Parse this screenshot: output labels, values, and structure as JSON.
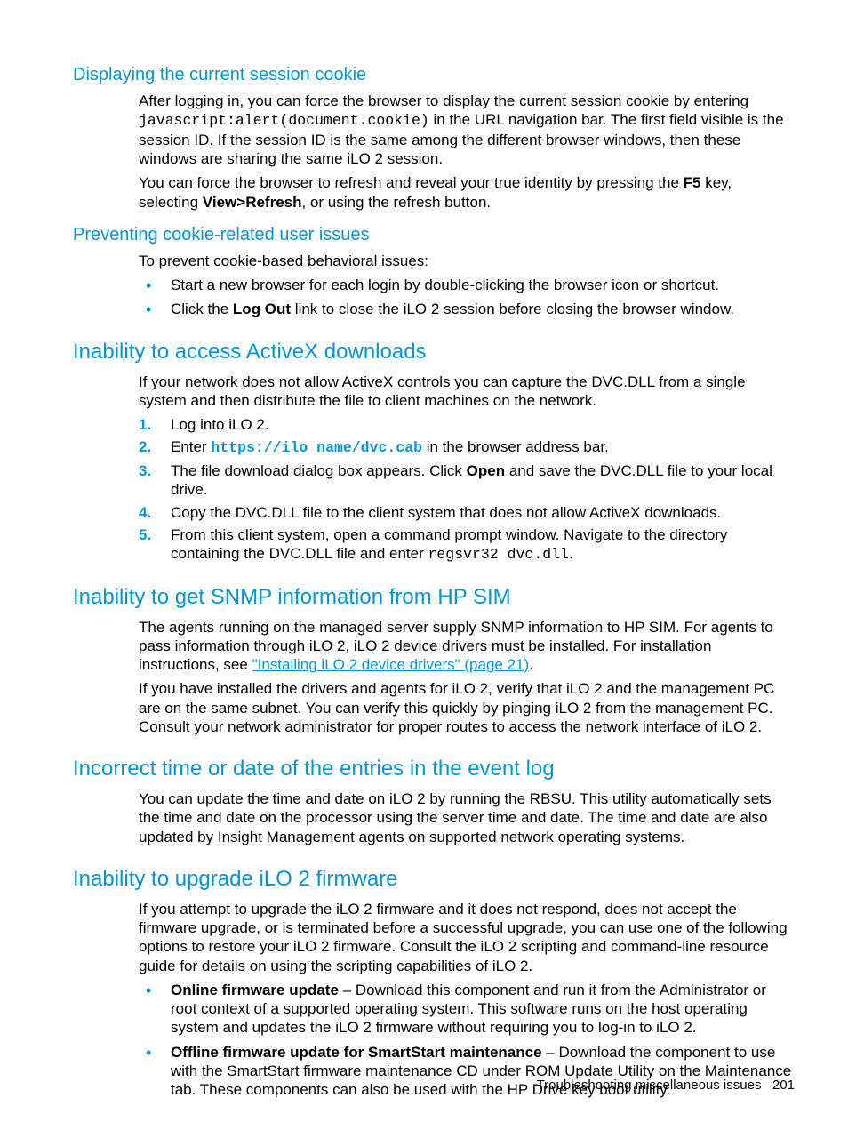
{
  "h_cookie_display": "Displaying the current session cookie",
  "p_cookie1a": "After logging in, you can force the browser to display the current session cookie by entering ",
  "p_cookie1_code": "javascript:alert(document.cookie)",
  "p_cookie1b": " in the URL navigation bar. The first field visible is the session ID. If the session ID is the same among the different browser windows, then these windows are sharing the same iLO 2 session.",
  "p_cookie2a": "You can force the browser to refresh and reveal your true identity by pressing the ",
  "p_cookie2_f5": "F5",
  "p_cookie2b": " key, selecting ",
  "p_cookie2_view": "View>Refresh",
  "p_cookie2c": ", or using the refresh button.",
  "h_prevent": "Preventing cookie-related user issues",
  "p_prevent_intro": "To prevent cookie-based behavioral issues:",
  "li_prevent1": "Start a new browser for each login by double-clicking the browser icon or shortcut.",
  "li_prevent2a": "Click the ",
  "li_prevent2b": "Log Out",
  "li_prevent2c": " link to close the iLO 2 session before closing the browser window.",
  "h_activex": "Inability to access ActiveX downloads",
  "p_activex_intro": "If your network does not allow ActiveX controls you can capture the DVC.DLL from a single system and then distribute the file to client machines on the network.",
  "li_ax1": "Log into iLO 2.",
  "li_ax2a": "Enter ",
  "li_ax2_link": "https://ilo_name/dvc.cab",
  "li_ax2b": " in the browser address bar.",
  "li_ax3a": "The file download dialog box appears. Click ",
  "li_ax3_open": "Open",
  "li_ax3b": " and save the DVC.DLL file to your local drive.",
  "li_ax4": "Copy the DVC.DLL file to the client system that does not allow ActiveX downloads.",
  "li_ax5a": "From this client system, open a command prompt window. Navigate to the directory containing the DVC.DLL file and enter ",
  "li_ax5_code": "regsvr32 dvc.dll",
  "li_ax5b": ".",
  "h_snmp": "Inability to get SNMP information from HP SIM",
  "p_snmp1a": "The agents running on the managed server supply SNMP information to HP SIM. For agents to pass information through iLO 2, iLO 2 device drivers must be installed. For installation instructions, see ",
  "p_snmp1_link": "\"Installing iLO 2 device drivers\" (page 21)",
  "p_snmp1b": ".",
  "p_snmp2": "If you have installed the drivers and agents for iLO 2, verify that iLO 2 and the management PC are on the same subnet. You can verify this quickly by pinging iLO 2 from the management PC. Consult your network administrator for proper routes to access the network interface of iLO 2.",
  "h_time": "Incorrect time or date of the entries in the event log",
  "p_time": "You can update the time and date on iLO 2 by running the RBSU. This utility automatically sets the time and date on the processor using the server time and date. The time and date are also updated by Insight Management agents on supported network operating systems.",
  "h_fw": "Inability to upgrade iLO 2 firmware",
  "p_fw_intro": "If you attempt to upgrade the iLO 2 firmware and it does not respond, does not accept the firmware upgrade, or is terminated before a successful upgrade, you can use one of the following options to restore your iLO 2 firmware. Consult the iLO 2 scripting and command-line resource guide for details on using the scripting capabilities of iLO 2.",
  "li_fw1_b": "Online firmware update",
  "li_fw1": " – Download this component and run it from the Administrator or root context of a supported operating system. This software runs on the host operating system and updates the iLO 2 firmware without requiring you to log-in to iLO 2.",
  "li_fw2_b": "Offline firmware update for SmartStart maintenance",
  "li_fw2": " – Download the component to use with the SmartStart firmware maintenance CD under ROM Update Utility on the Maintenance tab. These components can also be used with the HP Drive key boot utility.",
  "footer_text": "Troubleshooting miscellaneous issues",
  "footer_page": "201"
}
